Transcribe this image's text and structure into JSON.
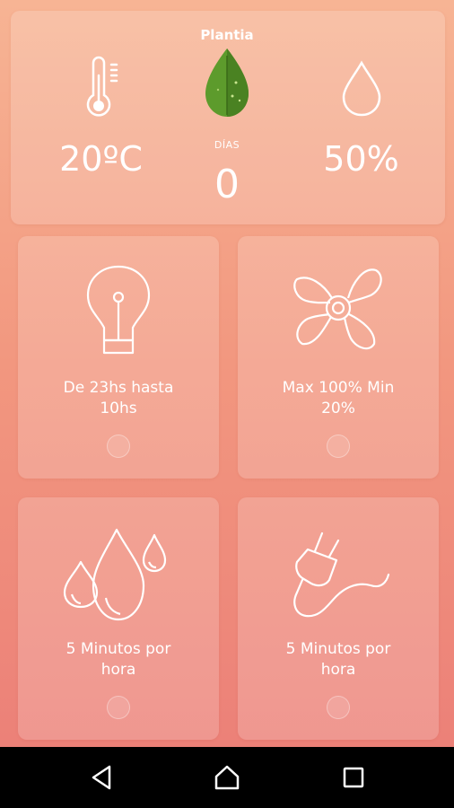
{
  "header": {
    "plant_name": "Plantia",
    "temperature": "20ºC",
    "days_label": "DÍAS",
    "days_value": "0",
    "humidity": "50%"
  },
  "tiles": [
    {
      "icon": "lightbulb-icon",
      "line1": "De 23hs hasta",
      "line2": "10hs"
    },
    {
      "icon": "fan-icon",
      "line1": "Max 100% Min",
      "line2": "20%"
    },
    {
      "icon": "water-drops-icon",
      "line1": "5 Minutos por",
      "line2": "hora"
    },
    {
      "icon": "power-plug-icon",
      "line1": "5 Minutos por",
      "line2": "hora"
    }
  ],
  "navbar": {
    "back": "back-triangle-icon",
    "home": "home-icon",
    "recents": "recents-square-icon"
  },
  "colors": {
    "gradient_top": "#f7b494",
    "gradient_bottom": "#eb7d77",
    "leaf_green": "#5d9b2c",
    "text": "#ffffff"
  }
}
